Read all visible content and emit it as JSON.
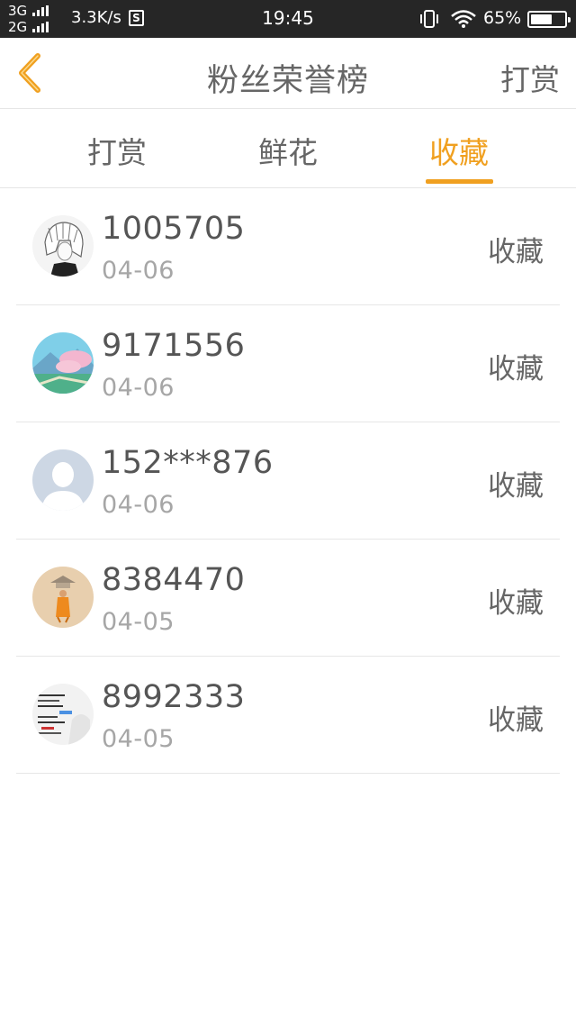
{
  "status_bar": {
    "network_top": "3G",
    "network_bottom": "2G",
    "speed": "3.3K/s",
    "sim_label": "S",
    "time": "19:45",
    "battery": "65%",
    "battery_level": 0.65
  },
  "header": {
    "title": "粉丝荣誉榜",
    "action": "打赏",
    "back_icon": "chevron-left-icon"
  },
  "tabs": [
    {
      "label": "打赏",
      "active": false
    },
    {
      "label": "鲜花",
      "active": false
    },
    {
      "label": "收藏",
      "active": true
    }
  ],
  "entries": [
    {
      "name": "1005705",
      "date": "04-06",
      "action": "收藏",
      "avatar": "anime-sketch-avatar"
    },
    {
      "name": "9171556",
      "date": "04-06",
      "action": "收藏",
      "avatar": "landscape-avatar"
    },
    {
      "name": "152***876",
      "date": "04-06",
      "action": "收藏",
      "avatar": "default-person-avatar"
    },
    {
      "name": "8384470",
      "date": "04-05",
      "action": "收藏",
      "avatar": "monk-avatar"
    },
    {
      "name": "8992333",
      "date": "04-05",
      "action": "收藏",
      "avatar": "text-image-avatar"
    }
  ],
  "colors": {
    "accent": "#f0a020",
    "status_bar": "#262626",
    "divider": "#e6e6e6"
  }
}
